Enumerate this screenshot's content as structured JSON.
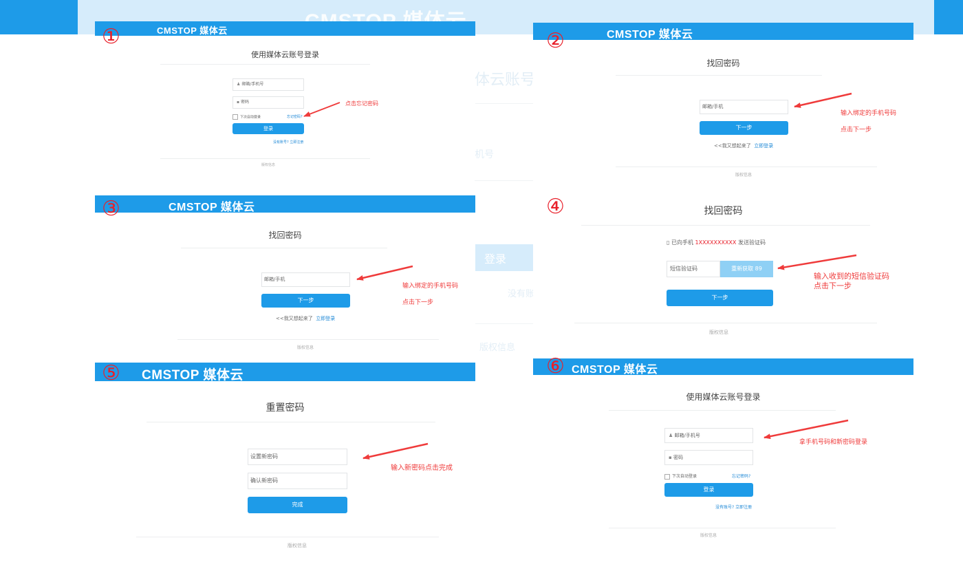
{
  "logo": {
    "brand": "CMSTOP",
    "name": "媒体云"
  },
  "background": {
    "title_fragment": "体云账号",
    "field_fragment": "机号",
    "login_button": "登录",
    "register_fragment": "没有账",
    "copyright_fragment": "版权信息"
  },
  "steps": [
    {
      "number": "①",
      "title": "使用媒体云账号登录",
      "account_placeholder": "邮箱/手机号",
      "password_placeholder": "密码",
      "remember_label": "下次自动登录",
      "forgot_link": "忘记密码?",
      "login_button": "登录",
      "register_text": "没有账号?",
      "register_link": "立即注册",
      "footer": "版权信息",
      "annotation": "点击忘记密码"
    },
    {
      "number": "②",
      "title": "找回密码",
      "phone_placeholder": "邮箱/手机",
      "next_button": "下一步",
      "back_text": "<<我又想起来了",
      "back_link": "立即登录",
      "footer": "版权信息",
      "annotation_1": "输入绑定的手机号码",
      "annotation_2": "点击下一步"
    },
    {
      "number": "③",
      "title": "找回密码",
      "phone_placeholder": "邮箱/手机",
      "next_button": "下一步",
      "back_text": "<<我又想起来了",
      "back_link": "立即登录",
      "footer": "版权信息",
      "annotation_1": "输入绑定的手机号码",
      "annotation_2": "点击下一步"
    },
    {
      "number": "④",
      "title": "找回密码",
      "sent_prefix": "已向手机",
      "sent_phone": "1XXXXXXXXXX",
      "sent_suffix": "发送验证码",
      "code_placeholder": "短信验证码",
      "resend_button": "重新获取 89",
      "next_button": "下一步",
      "footer": "版权信息",
      "annotation_1": "输入收到的短信验证码",
      "annotation_2": "点击下一步"
    },
    {
      "number": "⑤",
      "title": "重置密码",
      "new_password_placeholder": "设置新密码",
      "confirm_password_placeholder": "确认新密码",
      "done_button": "完成",
      "footer": "版权信息",
      "annotation": "输入新密码点击完成"
    },
    {
      "number": "⑥",
      "title": "使用媒体云账号登录",
      "account_placeholder": "邮箱/手机号",
      "password_placeholder": "密码",
      "remember_label": "下次自动登录",
      "forgot_link": "忘记密码?",
      "login_button": "登录",
      "register_text": "没有账号?",
      "register_link": "立即注册",
      "footer": "版权信息",
      "annotation": "拿手机号码和新密码登录"
    }
  ],
  "colors": {
    "brand_blue": "#1e9be8",
    "annotation_red": "#ef3b3b",
    "light_blue": "#d6ecfb"
  }
}
